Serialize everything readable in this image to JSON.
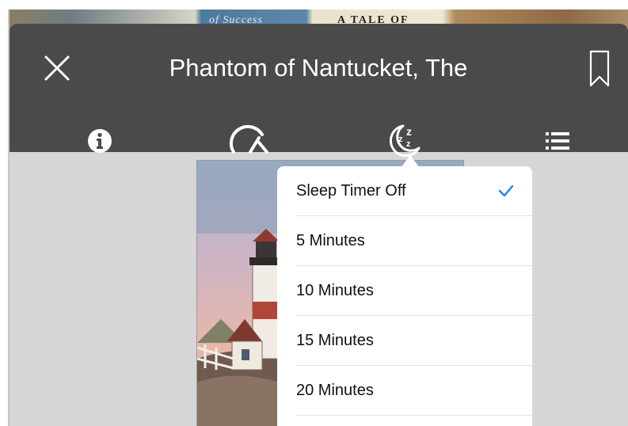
{
  "header": {
    "title": "Phantom of Nantucket, The"
  },
  "background_strip": {
    "texts": [
      "of Success",
      "A TALE OF"
    ]
  },
  "tabs": [
    {
      "name": "info",
      "icon": "info-icon"
    },
    {
      "name": "playback-speed",
      "icon": "speedometer-icon"
    },
    {
      "name": "sleep-timer",
      "icon": "sleep-moon-icon"
    },
    {
      "name": "chapters",
      "icon": "list-icon"
    }
  ],
  "sleep_timer_menu": {
    "items": [
      {
        "label": "Sleep Timer Off",
        "selected": true
      },
      {
        "label": "5 Minutes",
        "selected": false
      },
      {
        "label": "10 Minutes",
        "selected": false
      },
      {
        "label": "15 Minutes",
        "selected": false
      },
      {
        "label": "20 Minutes",
        "selected": false
      }
    ]
  },
  "colors": {
    "header_bg": "#4a4a4a",
    "accent": "#1a82fb",
    "content_bg": "#d6d6d6"
  }
}
